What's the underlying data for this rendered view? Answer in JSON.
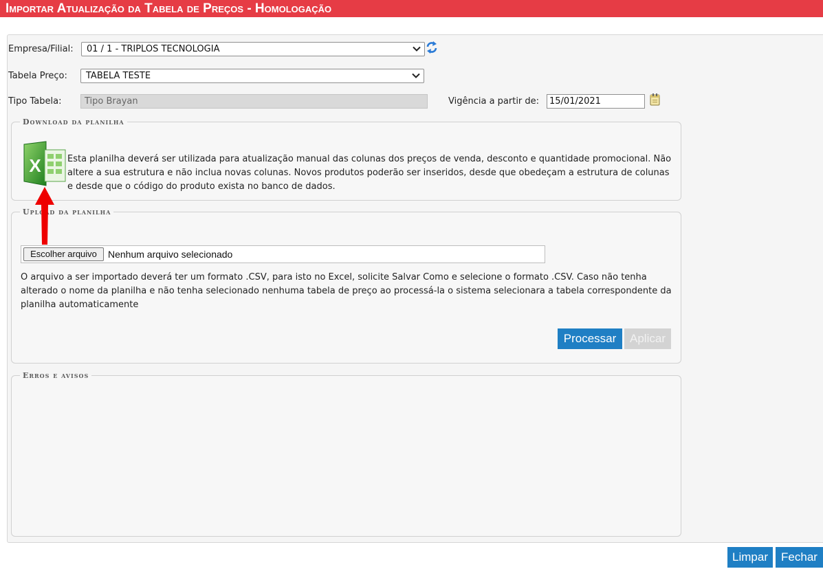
{
  "window": {
    "title": "Importar Atualização da Tabela de Preços  - Homologação"
  },
  "form": {
    "empresa_label": "Empresa/Filial:",
    "empresa_value": "01 / 1 - TRIPLOS TECNOLOGIA",
    "tabela_label": "Tabela Preço:",
    "tabela_value": "TABELA TESTE",
    "tipo_label": "Tipo Tabela:",
    "tipo_value": "Tipo Brayan",
    "vigencia_label": "Vigência a partir de:",
    "vigencia_value": "15/01/2021"
  },
  "download_section": {
    "legend": "Download da planilha",
    "text": "Esta planilha deverá ser utilizada para atualização manual das colunas dos preços de venda, desconto e quantidade promocional. Não altere a sua estrutura e não inclua novas colunas. Novos produtos poderão ser inseridos, desde que obedeçam a estrutura de colunas e desde que o código do produto exista no banco de dados.",
    "icon": "excel-icon"
  },
  "upload_section": {
    "legend": "Upload da planilha",
    "choose_file_label": "Escolher arquivo",
    "no_file_text": "Nenhum arquivo selecionado",
    "text": "O arquivo a ser importado deverá ter um formato .CSV, para isto no Excel, solicite Salvar Como e selecione o formato .CSV. Caso não tenha alterado o nome da planilha e não tenha selecionado nenhuma tabela de preço ao processá-la o sistema selecionara a tabela correspondente da planilha automaticamente",
    "process_label": "Processar",
    "apply_label": "Aplicar"
  },
  "errors_section": {
    "legend": "Erros e avisos"
  },
  "footer": {
    "clear_label": "Limpar",
    "close_label": "Fechar"
  },
  "colors": {
    "title_bar": "#e63c45",
    "primary_button": "#1f7fc4",
    "disabled_button": "#d3d3d3",
    "annotation_arrow": "#ee0000"
  },
  "icons": [
    "refresh-icon",
    "calendar-icon",
    "excel-icon",
    "chevron-down-icon",
    "red-arrow"
  ]
}
